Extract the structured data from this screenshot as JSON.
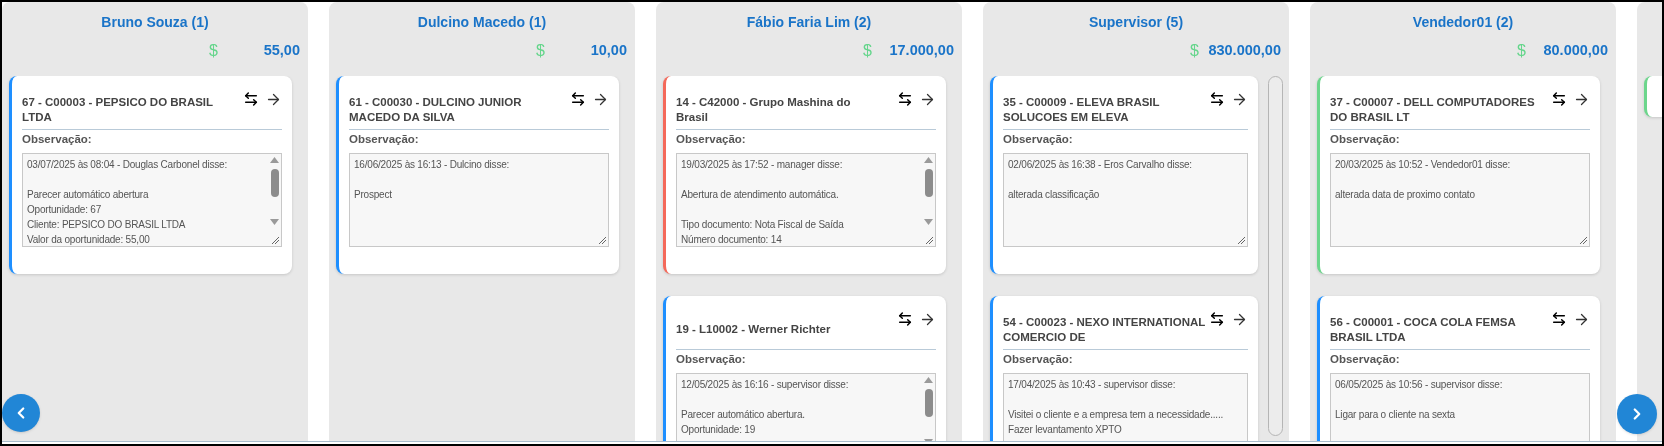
{
  "columns": [
    {
      "title": "Bruno Souza (1)",
      "currency": "$",
      "amount": "55,00",
      "scrollable": false,
      "cards": [
        {
          "color": "#1e8fff",
          "title": "67 - C00003 - PEPSICO DO BRASIL LTDA",
          "label": "Observação:",
          "note": "03/07/2025 às 08:04 - Douglas Carbonel disse:\n\nParecer automático abertura\nOportunidade: 67\nCliente: PEPSICO DO BRASIL LTDA\nValor da oportunidade: 55,00",
          "overflow": true
        }
      ]
    },
    {
      "title": "Dulcino Macedo (1)",
      "currency": "$",
      "amount": "10,00",
      "scrollable": false,
      "cards": [
        {
          "color": "#1e8fff",
          "title": "61 - C00030 - DULCINO JUNIOR MACEDO DA SILVA",
          "label": "Observação:",
          "note": "16/06/2025 às 16:13 - Dulcino disse:\n\nProspect",
          "overflow": false
        }
      ]
    },
    {
      "title": "Fábio Faria Lim (2)",
      "currency": "$",
      "amount": "17.000,00",
      "scrollable": false,
      "cards": [
        {
          "color": "#f4695a",
          "title": "14 - C42000 - Grupo Mashina do Brasil",
          "label": "Observação:",
          "note": "19/03/2025 às 17:52 - manager disse:\n\nAbertura de atendimento automática.\n\nTipo documento: Nota Fiscal de Saída\nNúmero documento: 14",
          "overflow": true
        },
        {
          "color": "#1e8fff",
          "title": "19 - L10002 - Werner Richter",
          "label": "Observação:",
          "note": "12/05/2025 às 16:16 - supervisor disse:\n\nParecer automático abertura.\nOportunidade: 19",
          "overflow": true
        }
      ]
    },
    {
      "title": "Supervisor (5)",
      "currency": "$",
      "amount": "830.000,00",
      "scrollable": true,
      "cards": [
        {
          "color": "#1e8fff",
          "title": "35 - C00009 - ELEVA BRASIL SOLUCOES EM ELEVA",
          "label": "Observação:",
          "note": "02/06/2025 às 16:38 - Eros Carvalho disse:\n\nalterada classificação",
          "overflow": false
        },
        {
          "color": "#1e8fff",
          "title": "54 - C00023 - NEXO INTERNATIONAL COMERCIO DE",
          "label": "Observação:",
          "note": "17/04/2025 às 10:43 - supervisor disse:\n\nVisitei o cliente e a empresa tem a necessidade.....\nFazer levantamento XPTO",
          "overflow": false
        }
      ]
    },
    {
      "title": "Vendedor01 (2)",
      "currency": "$",
      "amount": "80.000,00",
      "scrollable": false,
      "cards": [
        {
          "color": "#6cd68c",
          "title": "37 - C00007 - DELL COMPUTADORES DO BRASIL LT",
          "label": "Observação:",
          "note": "20/03/2025 às 10:52 - Vendedor01 disse:\n\nalterada data de proximo contato",
          "overflow": false
        },
        {
          "color": "#1e8fff",
          "title": "56 - C00001 - COCA COLA FEMSA BRASIL LTDA",
          "label": "Observação:",
          "note": "06/05/2025 às 10:56 - supervisor disse:\n\nLigar para o cliente na sexta",
          "overflow": false
        }
      ]
    },
    {
      "cards": [
        {
          "color": "#6cd68c"
        }
      ]
    }
  ]
}
